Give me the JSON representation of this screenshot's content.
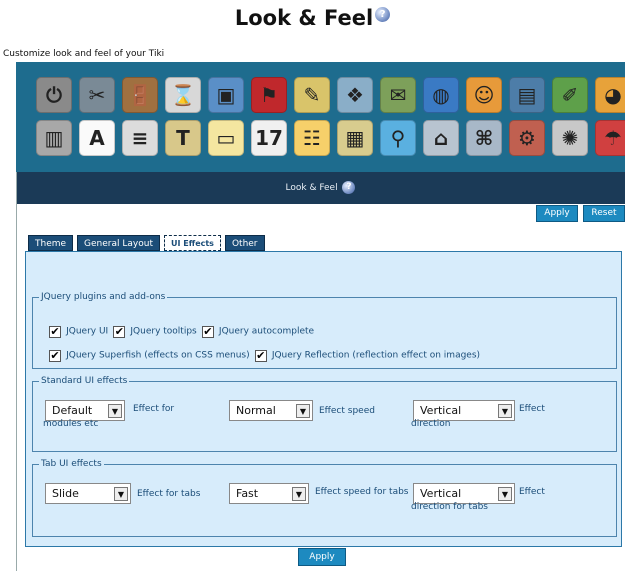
{
  "header": {
    "title": "Look & Feel",
    "subtitle": "Customize look and feel of your Tiki",
    "help_glyph": "?"
  },
  "icons": {
    "row1": [
      {
        "name": "power-icon",
        "glyph": "⏻",
        "color": "#8a8a8a"
      },
      {
        "name": "tools-icon",
        "glyph": "✂",
        "color": "#7a8a96"
      },
      {
        "name": "login-door-icon",
        "glyph": "🚪",
        "color": "#a07040"
      },
      {
        "name": "hourglass-icon",
        "glyph": "⌛",
        "color": "#d8d8d8"
      },
      {
        "name": "window-icon",
        "glyph": "▣",
        "color": "#5a8fc7"
      },
      {
        "name": "flag-icon",
        "glyph": "⚑",
        "color": "#c0282c"
      },
      {
        "name": "notepad-icon",
        "glyph": "✎",
        "color": "#d9c46a"
      },
      {
        "name": "categories-icon",
        "glyph": "❖",
        "color": "#8aaec8"
      },
      {
        "name": "mail-icon",
        "glyph": "✉",
        "color": "#7da05a"
      },
      {
        "name": "globe-icon",
        "glyph": "◍",
        "color": "#3a7ac4"
      },
      {
        "name": "users-icon",
        "glyph": "☺",
        "color": "#e79a3a"
      },
      {
        "name": "document-icon",
        "glyph": "▤",
        "color": "#4d7da8"
      },
      {
        "name": "edit-icon",
        "glyph": "✐",
        "color": "#5ea04a"
      },
      {
        "name": "palette-icon",
        "glyph": "◕",
        "color": "#e7a23a"
      }
    ],
    "row2": [
      {
        "name": "cards-icon",
        "glyph": "▥",
        "color": "#a8a8a8"
      },
      {
        "name": "font-icon",
        "glyph": "A",
        "color": "#fafafa"
      },
      {
        "name": "list-icon",
        "glyph": "≡",
        "color": "#dcdcdc"
      },
      {
        "name": "text-icon",
        "glyph": "T",
        "color": "#d8c88a"
      },
      {
        "name": "page-icon",
        "glyph": "▭",
        "color": "#f4e6a0"
      },
      {
        "name": "calendar-icon",
        "glyph": "17",
        "color": "#f0f0f0"
      },
      {
        "name": "forms-icon",
        "glyph": "☷",
        "color": "#f6d06a"
      },
      {
        "name": "tracker-icon",
        "glyph": "▦",
        "color": "#d8cc8e"
      },
      {
        "name": "search-icon",
        "glyph": "⚲",
        "color": "#5ab0e0"
      },
      {
        "name": "comm-icon",
        "glyph": "⌂",
        "color": "#b8c4d0"
      },
      {
        "name": "workspace-icon",
        "glyph": "⌘",
        "color": "#a8b8c8"
      },
      {
        "name": "plugins-icon",
        "glyph": "⚙",
        "color": "#c06050"
      },
      {
        "name": "brain-icon",
        "glyph": "✺",
        "color": "#c8c8c8"
      },
      {
        "name": "rating-icon",
        "glyph": "☂",
        "color": "#d04040"
      }
    ]
  },
  "section": {
    "title": "Look & Feel"
  },
  "buttons": {
    "apply_top": "Apply",
    "reset": "Reset",
    "apply_bottom": "Apply"
  },
  "tabs": [
    "Theme",
    "General Layout",
    "UI Effects",
    "Other"
  ],
  "jquery": {
    "legend": "JQuery plugins and add-ons",
    "items": [
      {
        "label": "JQuery UI",
        "checked": true
      },
      {
        "label": "JQuery tooltips",
        "checked": true
      },
      {
        "label": "JQuery autocomplete",
        "checked": true
      },
      {
        "label": "JQuery Superfish (effects on CSS menus)",
        "checked": true
      },
      {
        "label": "JQuery Reflection (reflection effect on images)",
        "checked": true
      }
    ]
  },
  "standard": {
    "legend": "Standard UI effects",
    "effect_value": "Default",
    "effect_label": "Effect for modules etc",
    "speed_value": "Normal",
    "speed_label": "Effect speed",
    "direction_value": "Vertical",
    "direction_label": "Effect direction"
  },
  "tab_ui": {
    "legend": "Tab UI effects",
    "effect_value": "Slide",
    "effect_label": "Effect for tabs",
    "speed_value": "Fast",
    "speed_label": "Effect speed for tabs",
    "direction_value": "Vertical",
    "direction_label": "Effect direction for tabs"
  },
  "colors": {
    "panel": "#1e6c8e",
    "nav": "#1b3a57",
    "content_bg": "#d7ecfb",
    "button": "#1d8ac0"
  }
}
